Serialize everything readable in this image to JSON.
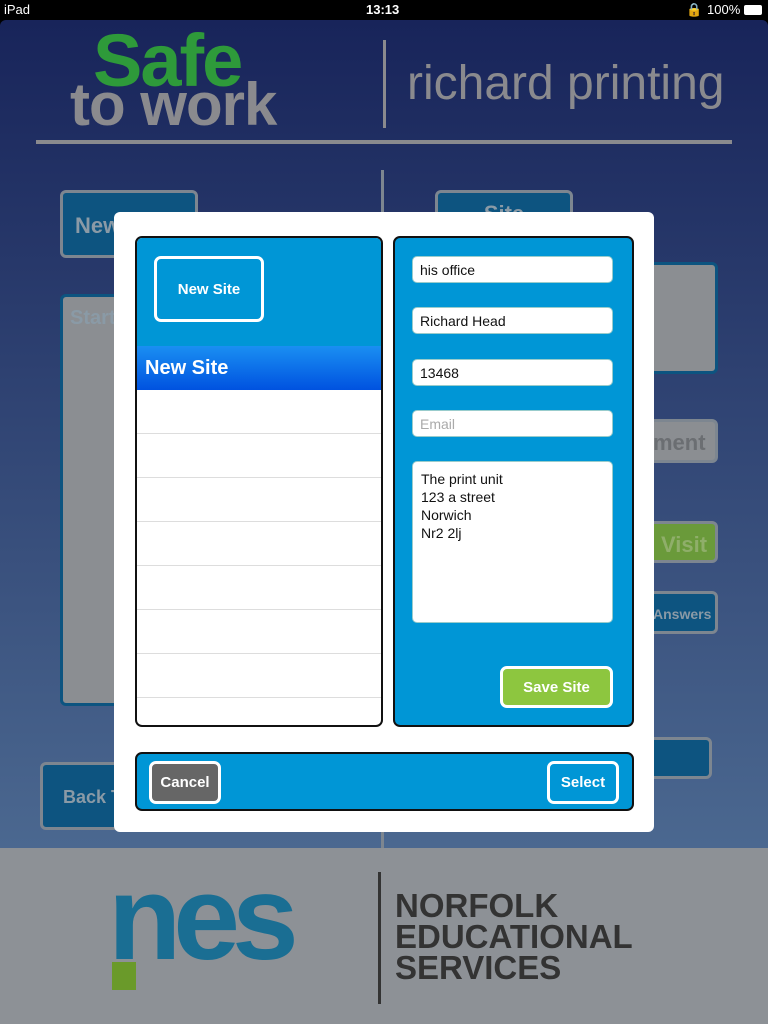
{
  "status_bar": {
    "device": "iPad",
    "time": "13:13",
    "battery": "100%"
  },
  "header": {
    "logo_line1": "Safe",
    "logo_line2": "to work",
    "company": "richard printing"
  },
  "background": {
    "new_button": "New",
    "site_button": "Site",
    "start_panel": "Start",
    "assessment_button": "ment",
    "visit_button": "Visit",
    "answers_button": "Answers",
    "back_button": "Back T"
  },
  "modal": {
    "new_site_button": "New Site",
    "site_list": [
      {
        "label": "New Site",
        "selected": true
      }
    ],
    "form": {
      "name": "his office",
      "contact": "Richard Head",
      "phone": "13468",
      "email": "",
      "email_placeholder": "Email",
      "address": "The print unit\n123 a street\nNorwich\nNr2 2lj"
    },
    "save_button": "Save Site",
    "cancel_button": "Cancel",
    "select_button": "Select"
  },
  "footer": {
    "logo_text": "nes",
    "org_name_lines": [
      "NORFOLK",
      "EDUCATIONAL",
      "SERVICES"
    ]
  },
  "colors": {
    "accent_blue": "#0096d6",
    "save_green": "#8dc63f",
    "logo_green": "#2e9a3a",
    "nes_teal": "#1a6e93"
  }
}
